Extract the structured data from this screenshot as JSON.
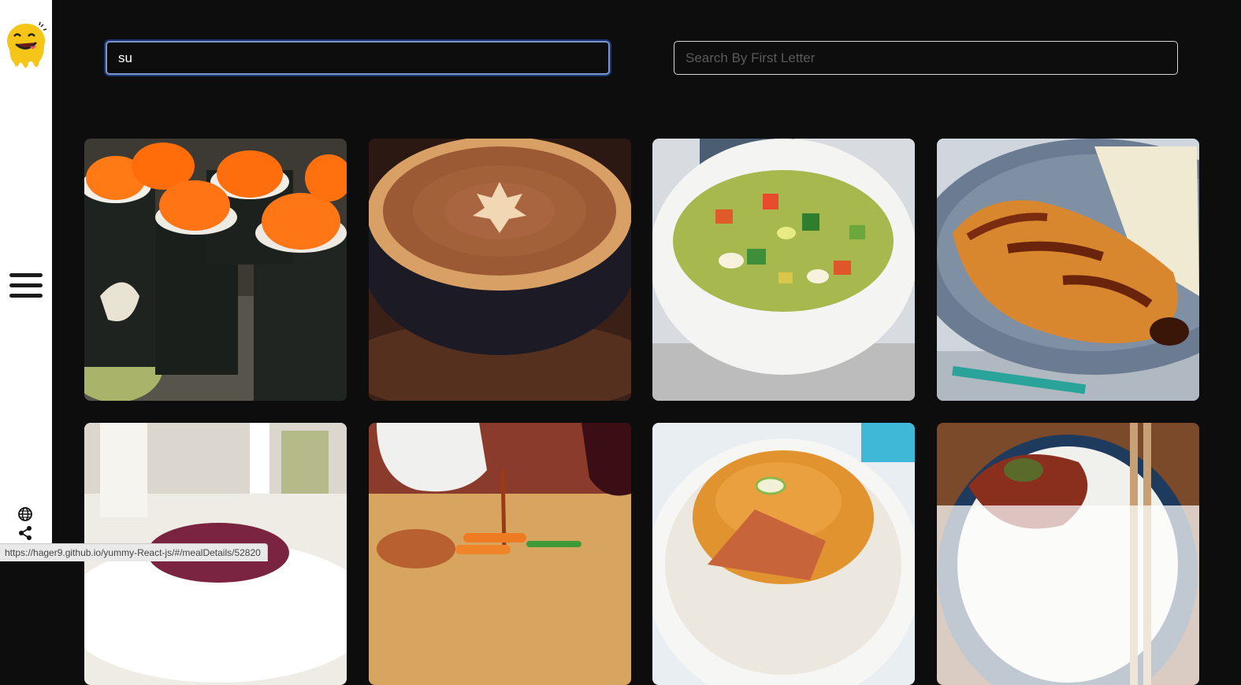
{
  "search": {
    "by_name_value": "su",
    "by_letter_placeholder": "Search By First Letter"
  },
  "sidebar": {
    "logo_icon": "smiling-face-logo",
    "menu_icon": "hamburger-icon",
    "bottom_icons": [
      "globe-icon",
      "share-icon"
    ]
  },
  "meals": [
    {
      "name": "sushi-image"
    },
    {
      "name": "pumpkin-pie-image"
    },
    {
      "name": "vegetable-soup-image"
    },
    {
      "name": "chicken-katsu-image"
    },
    {
      "name": "purple-dessert-image"
    },
    {
      "name": "roast-dinner-image"
    },
    {
      "name": "katsu-curry-rice-image"
    },
    {
      "name": "chicken-rice-bowl-image"
    }
  ],
  "status_bar": {
    "url": "https://hager9.github.io/yummy-React-js/#/mealDetails/52820"
  },
  "colors": {
    "sidebar_bg": "#ffffff",
    "page_bg": "#0d0d0d",
    "focus_ring": "#2a5ac8"
  }
}
